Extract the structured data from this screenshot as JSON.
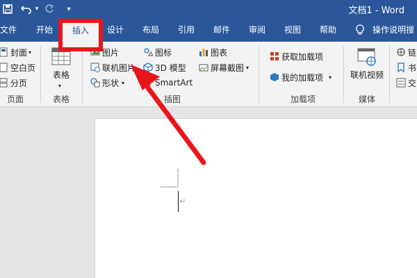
{
  "titlebar": {
    "save_icon": "save-icon",
    "undo_icon": "undo-icon",
    "redo_icon": "redo-icon",
    "customize_icon": "customize-quick-access-icon",
    "doc_title": "文档1 - Word"
  },
  "tabs": [
    {
      "label": "文件"
    },
    {
      "label": "开始"
    },
    {
      "label": "插入"
    },
    {
      "label": "设计"
    },
    {
      "label": "布局"
    },
    {
      "label": "引用"
    },
    {
      "label": "邮件"
    },
    {
      "label": "审阅"
    },
    {
      "label": "视图"
    },
    {
      "label": "帮助"
    },
    {
      "label": "操作说明搜"
    }
  ],
  "ribbon": {
    "pages": {
      "cover": "封面",
      "blank": "空白页",
      "break": "分页",
      "label": "页面"
    },
    "tables": {
      "table": "表格",
      "label": "表格"
    },
    "illustrations": {
      "pictures": "图片",
      "online_pictures": "联机图片",
      "shapes": "形状",
      "icons": "图标",
      "model3d": "3D 模型",
      "smartart": "SmartArt",
      "chart": "图表",
      "screenshot": "屏幕截图",
      "label": "插图"
    },
    "addins": {
      "get": "获取加载项",
      "mine": "我的加载项",
      "label": "加载项"
    },
    "media": {
      "online_video": "联机视频",
      "label": "媒体"
    },
    "links": {
      "link1": "链",
      "link2": "书",
      "link3": "交"
    }
  },
  "colors": {
    "brand": "#2b579a",
    "highlight": "#e8161c"
  }
}
